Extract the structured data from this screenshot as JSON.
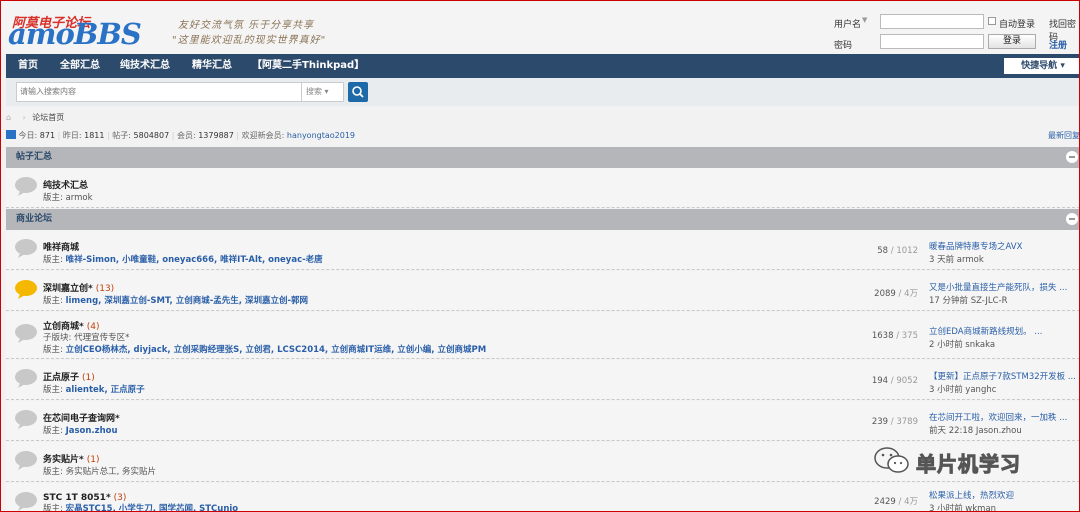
{
  "header": {
    "logo_top": "阿莫电子论坛",
    "logo_main_1": "amo",
    "logo_main_2": "BBS",
    "slogan_1": "友好交流气氛  乐于分享共享",
    "slogan_2": "\"这里能欢迎乱的现实世界真好\"",
    "username_label": "用户名",
    "password_label": "密码",
    "auto_login_label": "自动登录",
    "retrieve_password": "找回密码",
    "register": "注册",
    "login_button": "登录"
  },
  "nav": {
    "items": [
      "首页",
      "全部汇总",
      "纯技术汇总",
      "精华汇总",
      "【阿莫二手Thinkpad】"
    ],
    "quick_nav": "快捷导航"
  },
  "search": {
    "placeholder": "请输入搜索内容",
    "select": "搜索"
  },
  "breadcrumb": "论坛首页",
  "stats": {
    "today_label": "今日:",
    "today": "871",
    "yesterday_label": "昨日:",
    "yesterday": "1811",
    "posts_label": "帖子:",
    "posts": "5804807",
    "members_label": "会员:",
    "members": "1379887",
    "welcome_label": "欢迎新会员:",
    "newest_member": "hanyongtao2019",
    "latest_reply": "最新回复"
  },
  "categories": [
    {
      "title": "帖子汇总"
    },
    {
      "title": "商业论坛"
    }
  ],
  "forums": [
    {
      "name": "纯技术汇总",
      "count": "",
      "sub_label": "",
      "sub": "",
      "mod_label": "版主:",
      "mods": "",
      "mod_plain": "armok",
      "posts": "",
      "total": "",
      "last_title": "",
      "last_meta": "",
      "hot": false
    },
    {
      "name": "唯祥商城",
      "count": "",
      "sub_label": "",
      "sub": "",
      "mod_label": "版主:",
      "mods": "唯祥-Simon, 小唯童鞋, oneyac666, 唯祥IT-Alt, oneyac-老唐",
      "mod_plain": "",
      "posts": "58",
      "total": "1012",
      "last_title": "暖春品牌特惠专场之AVX",
      "last_meta": "3 天前 armok",
      "hot": false
    },
    {
      "name": "深圳嘉立创*",
      "count": "(13)",
      "sub_label": "",
      "sub": "",
      "mod_label": "版主:",
      "mods": "limeng, 深圳嘉立创-SMT, 立创商城-孟先生, 深圳嘉立创-郭网",
      "mod_plain": "",
      "posts": "2089",
      "total": "4万",
      "last_title": "又是小批量直接生产能死队，损失 ...",
      "last_meta": "17 分钟前 SZ-JLC-R",
      "hot": true
    },
    {
      "name": "立创商城*",
      "count": "(4)",
      "sub_label": "子版块:",
      "sub": "代理宣传专区*",
      "mod_label": "版主:",
      "mods": "立创CEO杨林杰, diyjack, 立创采购经理张S, 立创君, LCSC2014, 立创商城IT运维, 立创小编, 立创商城PM",
      "mod_plain": "",
      "posts": "1638",
      "total": "375",
      "last_title": "立创EDA商城新路线规划。 ...",
      "last_meta": "2 小时前 snkaka",
      "hot": false
    },
    {
      "name": "正点原子",
      "count": "(1)",
      "sub_label": "",
      "sub": "",
      "mod_label": "版主:",
      "mods": "alientek, 正点原子",
      "mod_plain": "",
      "posts": "194",
      "total": "9052",
      "last_title": "【更新】正点原子7款STM32开发板 ...",
      "last_meta": "3 小时前 yanghc",
      "hot": false
    },
    {
      "name": "在芯间电子查询网*",
      "count": "",
      "sub_label": "",
      "sub": "",
      "mod_label": "版主:",
      "mods": "Jason.zhou",
      "mod_plain": "",
      "posts": "239",
      "total": "3789",
      "last_title": "在芯间开工啦，欢迎回来，一加秩 ...",
      "last_meta": "前天 22:18 Jason.zhou",
      "hot": false
    },
    {
      "name": "务实贴片*",
      "count": "(1)",
      "sub_label": "",
      "sub": "",
      "mod_label": "版主:",
      "mods": "",
      "mod_plain": "务实贴片总工, 务实贴片",
      "posts": "",
      "total": "",
      "last_title": "",
      "last_meta": "",
      "hot": false
    },
    {
      "name": "STC 1T 8051*",
      "count": "(3)",
      "sub_label": "",
      "sub": "",
      "mod_label": "版主:",
      "mods": "宏晶STC15, 小学生刀, 国学芯闻, STCunio",
      "mod_plain": "",
      "posts": "2429",
      "total": "4万",
      "last_title": "松果派上线，热烈欢迎",
      "last_meta": "3 小时前 wkman",
      "hot": false
    }
  ],
  "watermark": "单片机学习",
  "colors": {
    "nav_bg": "#2c4a6b",
    "category_bar": "#b4b6ba",
    "link": "#2a5fa8",
    "hot_bubble": "#f5b800"
  }
}
